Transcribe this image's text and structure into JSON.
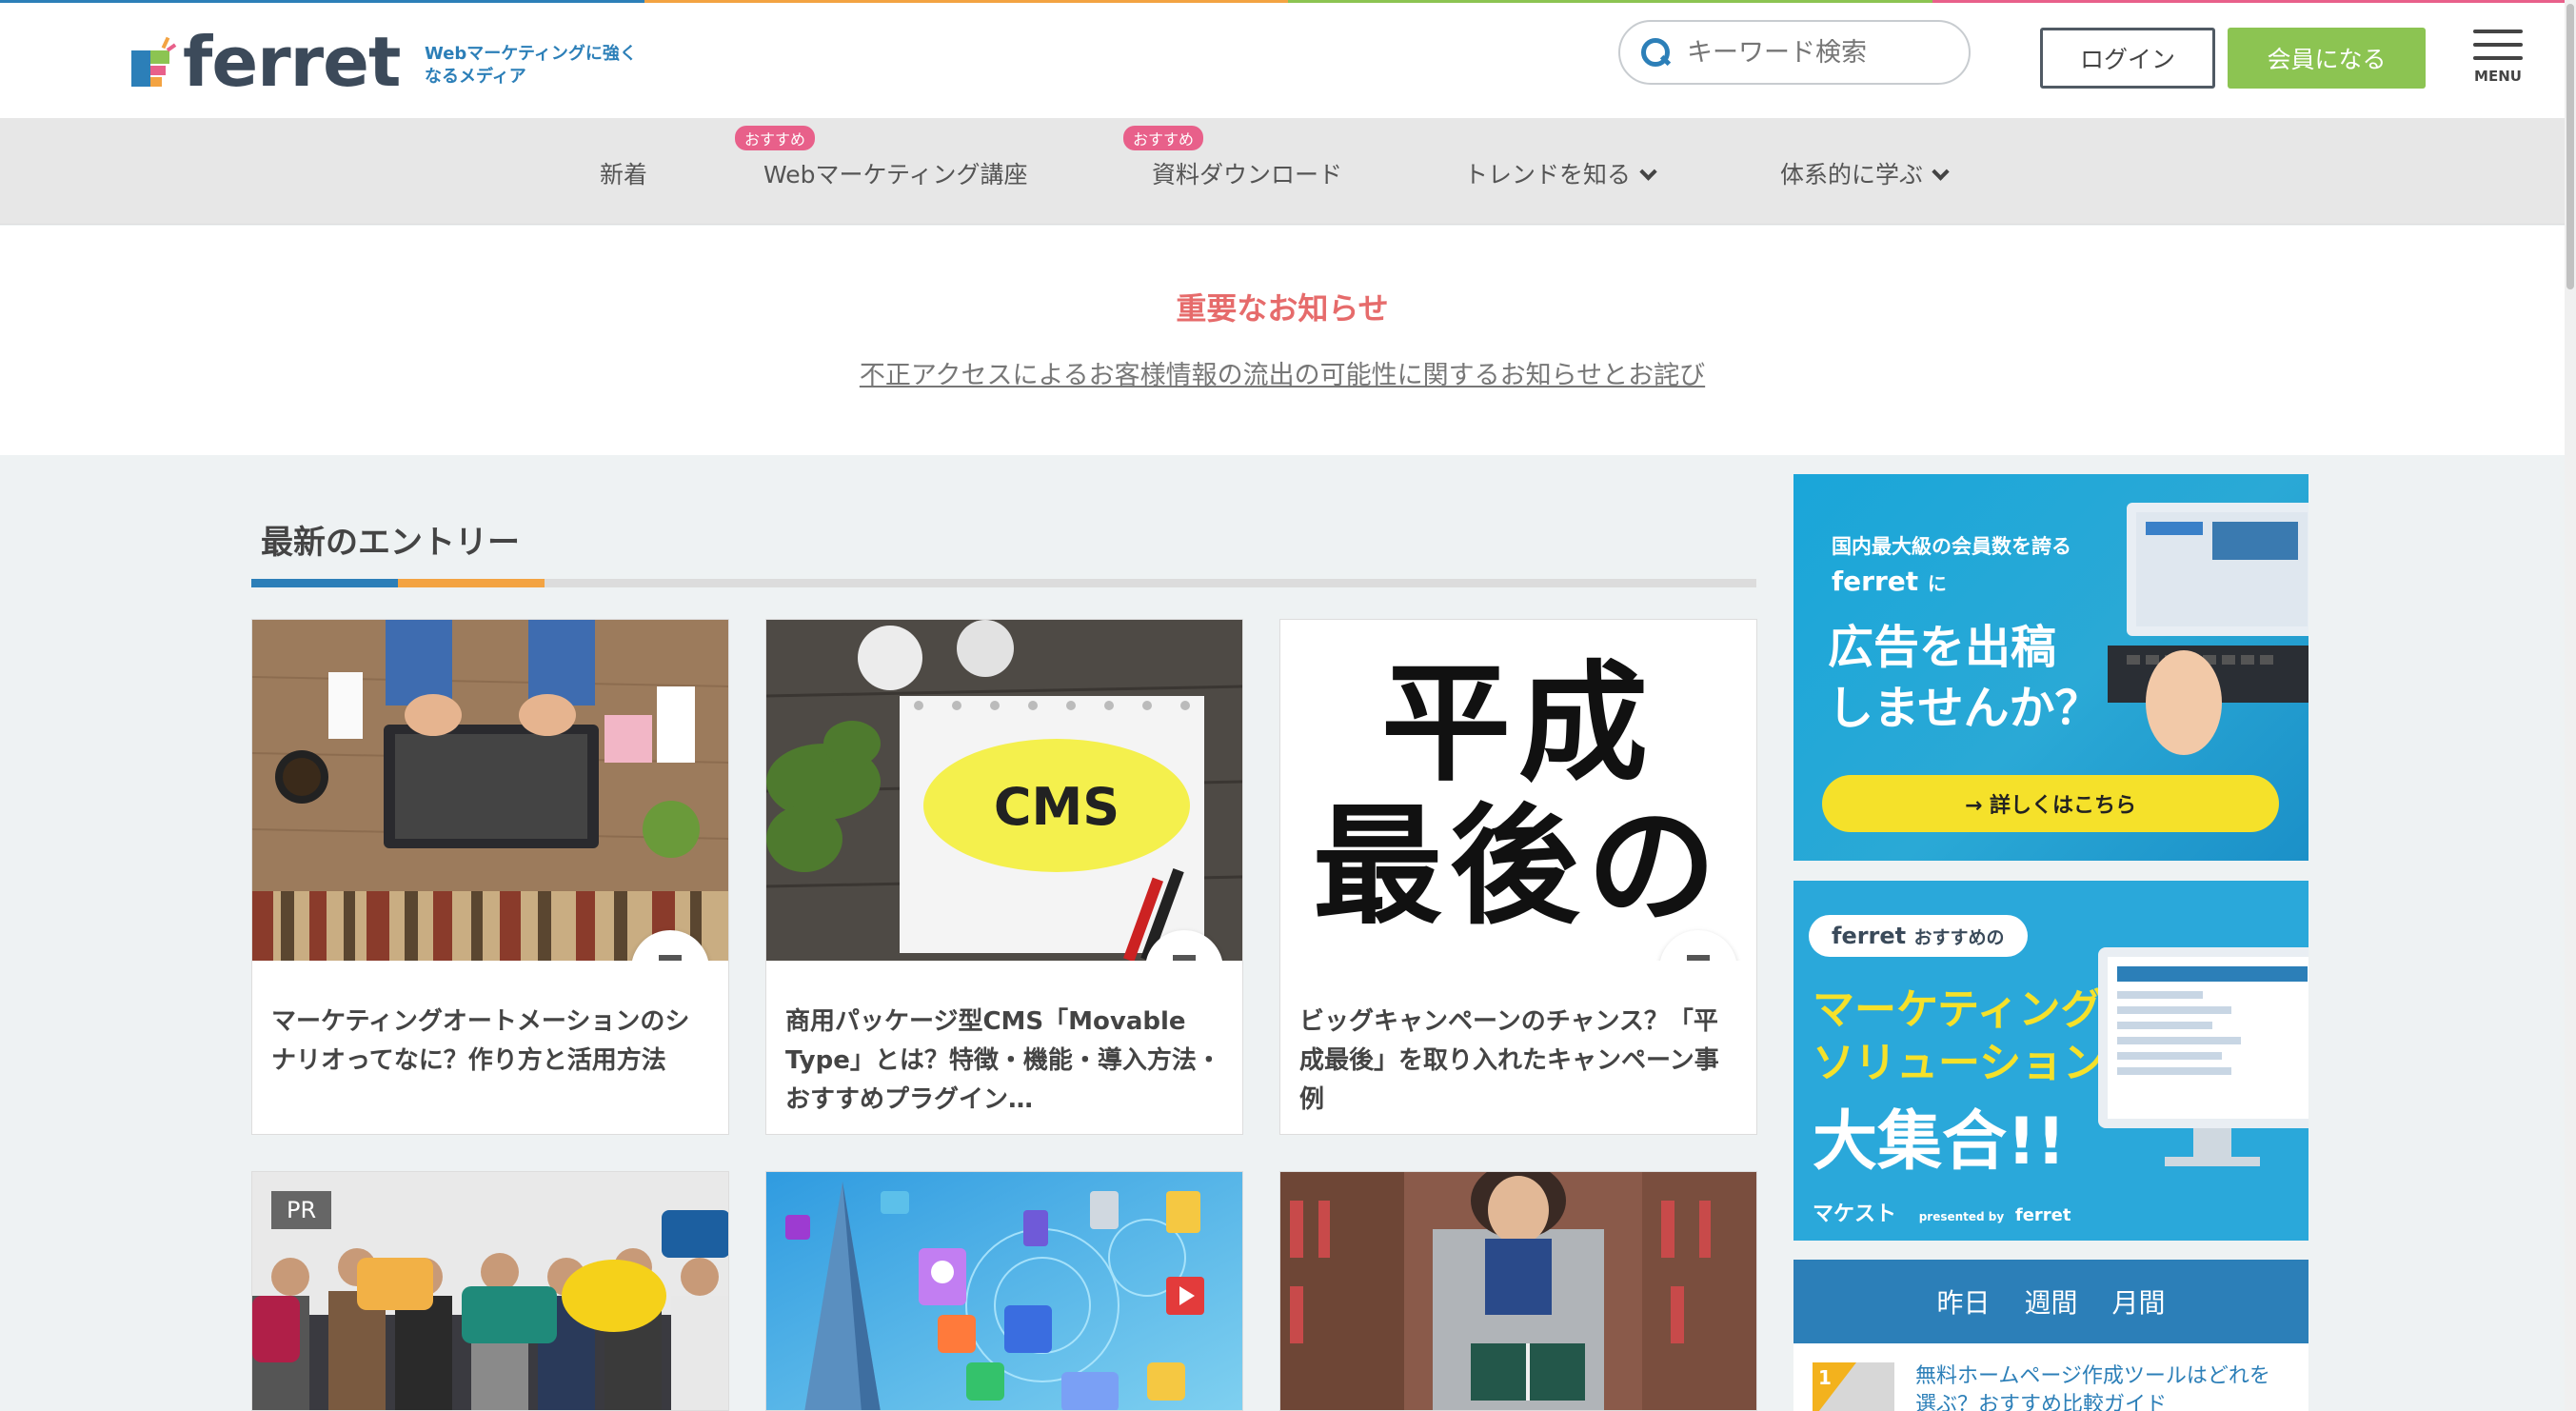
{
  "brand": {
    "name": "ferret",
    "tagline": "Webマーケティングに強くなるメディア"
  },
  "header": {
    "search_placeholder": "キーワード検索",
    "login_label": "ログイン",
    "join_label": "会員になる",
    "menu_label": "MENU"
  },
  "nav": {
    "items": [
      {
        "label": "新着",
        "badge": ""
      },
      {
        "label": "Webマーケティング講座",
        "badge": "おすすめ"
      },
      {
        "label": "資料ダウンロード",
        "badge": "おすすめ"
      },
      {
        "label": "トレンドを知る",
        "badge": ""
      },
      {
        "label": "体系的に学ぶ",
        "badge": ""
      }
    ]
  },
  "notice": {
    "title": "重要なお知らせ",
    "link": "不正アクセスによるお客様情報の流出の可能性に関するお知らせとお詫び"
  },
  "section": {
    "title": "最新のエントリー"
  },
  "cards": [
    {
      "title": "マーケティングオートメーションのシナリオってなに？作り方と活用方法"
    },
    {
      "title": "商用パッケージ型CMS「Movable Type」とは？特徴・機能・導入方法・おすすめプラグイン…",
      "image_text": "CMS"
    },
    {
      "title": "ビッグキャンペーンのチャンス？「平成最後」を取り入れたキャンペーン事例",
      "image_text_1": "平成",
      "image_text_2": "最後の"
    },
    {
      "title": "",
      "tag": "PR"
    },
    {
      "title": ""
    },
    {
      "title": ""
    }
  ],
  "ads": {
    "ad1": {
      "line1": "国内最大級の会員数を誇る",
      "brand": "ferret",
      "brand_suffix": "に",
      "headline1": "広告を出稿",
      "headline2": "しませんか？",
      "cta": "→ 詳しくはこちら"
    },
    "ad2": {
      "brand": "ferret",
      "badge_suffix": "おすすめの",
      "headline1": "マーケティング",
      "headline2": "ソリューション",
      "headline3": "大集合!!",
      "footer_brand": "マケスト",
      "footer_by": "presented by",
      "footer_ferret": "ferret"
    }
  },
  "ranking": {
    "tabs": [
      "昨日",
      "週間",
      "月間"
    ],
    "first": {
      "rank": "1",
      "text": "無料ホームページ作成ツールはどれを選ぶ？おすすめ比較ガイド"
    }
  },
  "colors": {
    "brand_blue": "#2c7fb8",
    "accent_orange": "#f3a342",
    "join_green": "#8cc452",
    "notice_red": "#e66b6b",
    "badge_pink": "#e8608a"
  }
}
